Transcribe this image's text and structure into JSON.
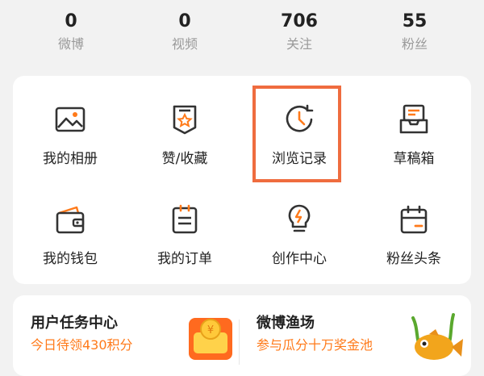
{
  "stats": [
    {
      "value": "0",
      "label": "微博"
    },
    {
      "value": "0",
      "label": "视频"
    },
    {
      "value": "706",
      "label": "关注"
    },
    {
      "value": "55",
      "label": "粉丝"
    }
  ],
  "grid": [
    {
      "label": "我的相册",
      "icon": "photo-album-icon"
    },
    {
      "label": "赞/收藏",
      "icon": "star-bookmark-icon"
    },
    {
      "label": "浏览记录",
      "icon": "history-clock-icon"
    },
    {
      "label": "草稿箱",
      "icon": "draft-box-icon"
    },
    {
      "label": "我的钱包",
      "icon": "wallet-icon"
    },
    {
      "label": "我的订单",
      "icon": "order-list-icon"
    },
    {
      "label": "创作中心",
      "icon": "lightbulb-icon"
    },
    {
      "label": "粉丝头条",
      "icon": "calendar-icon"
    }
  ],
  "tasks": [
    {
      "title": "用户任务中心",
      "subtitle": "今日待领430积分"
    },
    {
      "title": "微博渔场",
      "subtitle": "参与瓜分十万奖金池"
    }
  ],
  "colors": {
    "accent": "#ff7a1a",
    "highlight": "#ef6c3f",
    "icon": "#333333",
    "bg": "#f2f2f2"
  }
}
